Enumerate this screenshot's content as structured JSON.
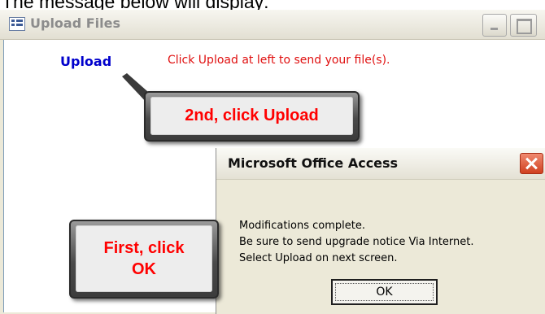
{
  "caption": "The message below will display:",
  "upload_window": {
    "title": "Upload Files",
    "upload_link": "Upload",
    "upload_message": "Click Upload at left to send your file(s)."
  },
  "callouts": {
    "upload": "2nd, click Upload",
    "ok_line1": "First, click",
    "ok_line2": "OK"
  },
  "dialog": {
    "title": "Microsoft Office Access",
    "lines": [
      "Modifications complete.",
      "Be sure to send upgrade notice Via Internet.",
      "Select Upload on next screen."
    ],
    "ok_label": "OK"
  },
  "colors": {
    "upload_link": "#0000cc",
    "message_red": "#e01010",
    "callout_text": "#ff0000"
  }
}
